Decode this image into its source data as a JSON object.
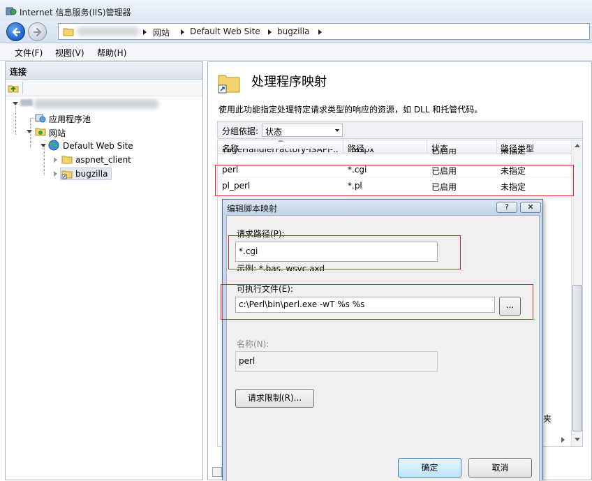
{
  "window": {
    "title": "Internet 信息服务(IIS)管理器"
  },
  "address": {
    "crumbs": [
      "网站",
      "Default Web Site",
      "bugzilla"
    ]
  },
  "menu": {
    "items": [
      "文件(F)",
      "视图(V)",
      "帮助(H)"
    ]
  },
  "connections": {
    "title": "连接",
    "tree": {
      "app_pools": "应用程序池",
      "sites": "网站",
      "default_site": "Default Web Site",
      "aspnet_client": "aspnet_client",
      "bugzilla": "bugzilla"
    }
  },
  "feature": {
    "title": "处理程序映射",
    "description": "使用此功能指定处理特定请求类型的响应的资源，如 DLL 和托管代码。",
    "group_by_label": "分组依据:",
    "group_by_value": "状态",
    "columns": [
      "名称",
      "路径",
      "状态",
      "路径类型"
    ],
    "rows": [
      {
        "name": "PageHandlerFactory-ISAPI-...",
        "path": "*.aspx",
        "state": "已启用",
        "path_type": "未指定"
      },
      {
        "name": "perl",
        "path": "*.cgi",
        "state": "已启用",
        "path_type": "未指定"
      },
      {
        "name": "pl_perl",
        "path": "*.pl",
        "state": "已启用",
        "path_type": "未指定"
      }
    ],
    "partial_text": "夹"
  },
  "dialog": {
    "title": "编辑脚本映射",
    "help_button": "?",
    "close_button": "✕",
    "request_path_label": "请求路径(P):",
    "request_path_value": "*.cgi",
    "request_path_example": "示例: *.bas, wsvc.axd",
    "executable_label": "可执行文件(E):",
    "executable_value": "c:\\Perl\\bin\\perl.exe -wT %s %s",
    "browse_button": "...",
    "name_label": "名称(N):",
    "name_value": "perl",
    "restrictions_button": "请求限制(R)...",
    "ok_button": "确定",
    "cancel_button": "取消"
  },
  "colors": {
    "annotation_red": "#ee2222",
    "dialog_frame": "#c7d6ea",
    "nav_back": "#1d5fc9"
  }
}
